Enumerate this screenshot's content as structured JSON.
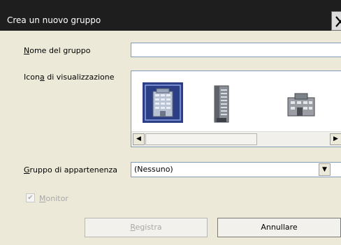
{
  "window": {
    "title": "Crea un nuovo gruppo"
  },
  "form": {
    "name_label_first": "N",
    "name_label_rest": "ome del gruppo",
    "name_value": "",
    "icon_label_pre": "Icon",
    "icon_label_u": "a",
    "icon_label_post": " di visualizzazione",
    "parent_label_first": "G",
    "parent_label_rest": "ruppo di appartenenza",
    "parent_value": "(Nessuno)",
    "monitor_label_first": "M",
    "monitor_label_rest": "onitor",
    "monitor_checked": true,
    "icons": [
      "office-building-icon",
      "skyscraper-icon",
      "low-building-icon"
    ],
    "selected_icon": 0
  },
  "buttons": {
    "register_first": "R",
    "register_rest": "egistra",
    "cancel": "Annullare"
  }
}
